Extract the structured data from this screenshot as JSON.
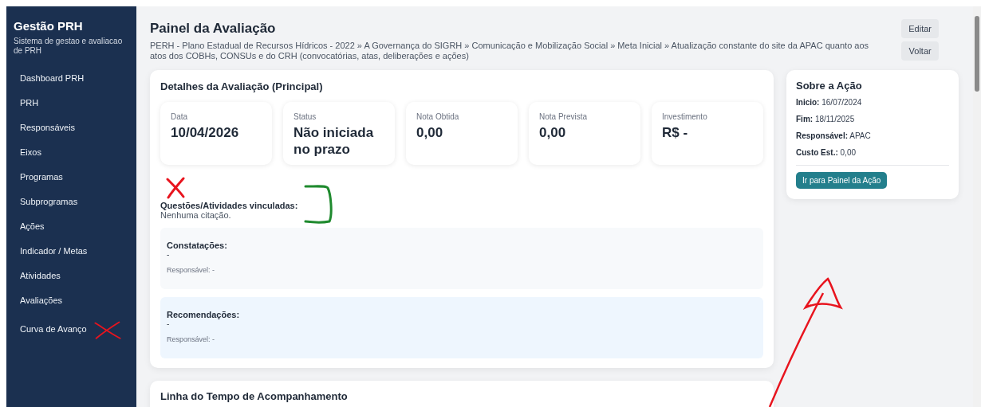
{
  "sidebar": {
    "title": "Gestão PRH",
    "subtitle": "Sistema de gestao e avaliacao de PRH",
    "items": [
      {
        "label": "Dashboard PRH",
        "struck": false
      },
      {
        "label": "PRH",
        "struck": false
      },
      {
        "label": "Responsáveis",
        "struck": false
      },
      {
        "label": "Eixos",
        "struck": false
      },
      {
        "label": "Programas",
        "struck": false
      },
      {
        "label": "Subprogramas",
        "struck": false
      },
      {
        "label": "Ações",
        "struck": false
      },
      {
        "label": "Indicador / Metas",
        "struck": false
      },
      {
        "label": "Atividades",
        "struck": false
      },
      {
        "label": "Avaliações",
        "struck": false
      },
      {
        "label": "Curva de Avanço",
        "struck": true
      }
    ]
  },
  "header": {
    "title": "Painel da Avaliação",
    "breadcrumb": "PERH - Plano Estadual de Recursos Hídricos - 2022 » A Governança do SIGRH » Comunicação e Mobilização Social » Meta Inicial » Atualização constante do site da APAC quanto aos atos dos COBHs, CONSUs e do CRH (convocatórias, atas, deliberações e ações)",
    "buttons": [
      "Editar",
      "Voltar"
    ]
  },
  "details": {
    "title": "Detalhes da Avaliação (Principal)",
    "stats": [
      {
        "label": "Data",
        "value": "10/04/2026"
      },
      {
        "label": "Status",
        "value": "Não iniciada no prazo"
      },
      {
        "label": "Nota Obtida",
        "value": "0,00"
      },
      {
        "label": "Nota Prevista",
        "value": "0,00"
      },
      {
        "label": "Investimento",
        "value": "R$ -"
      }
    ],
    "questoes": {
      "heading": "Questões/Atividades vinculadas:",
      "text": "Nenhuma citação.",
      "struck": true,
      "circled": true
    },
    "sections": [
      {
        "kind": "neutral",
        "heading": "Constatações:",
        "text": "-",
        "responsible": "Responsável: -"
      },
      {
        "kind": "info",
        "heading": "Recomendações:",
        "text": "-",
        "responsible": "Responsável: -"
      }
    ]
  },
  "action": {
    "title": "Sobre a Ação",
    "fields": [
      {
        "label": "Inicio:",
        "value": "16/07/2024"
      },
      {
        "label": "Fim:",
        "value": "18/11/2025"
      },
      {
        "label": "Responsável:",
        "value": "APAC"
      },
      {
        "label": "Custo Est.:",
        "value": "0,00"
      }
    ],
    "button": "Ir para Painel da Ação"
  },
  "timeline": {
    "title": "Linha do Tempo de Acompanhamento"
  },
  "annotations": [
    {
      "kind": "arrow",
      "color": "#e8141e"
    }
  ]
}
